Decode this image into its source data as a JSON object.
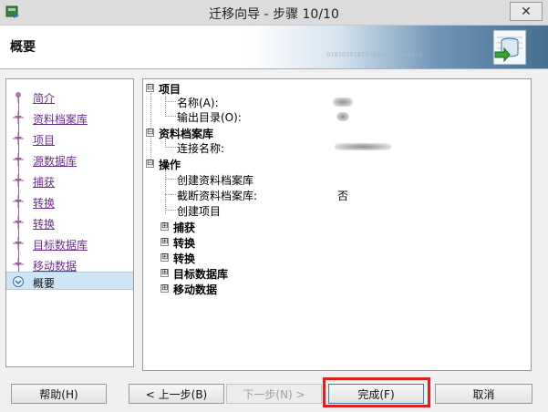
{
  "window": {
    "title": "迁移向导 - 步骤 10/10",
    "close_glyph": "✕"
  },
  "header": {
    "title": "概要",
    "binary_text": "0101010101010101010101010"
  },
  "nav": {
    "items": [
      {
        "label": "简介",
        "active": false
      },
      {
        "label": "资料档案库",
        "active": false
      },
      {
        "label": "项目",
        "active": false
      },
      {
        "label": "源数据库",
        "active": false
      },
      {
        "label": "捕获",
        "active": false
      },
      {
        "label": "转换",
        "active": false
      },
      {
        "label": "转换",
        "active": false
      },
      {
        "label": "目标数据库",
        "active": false
      },
      {
        "label": "移动数据",
        "active": false
      },
      {
        "label": "概要",
        "active": true
      }
    ]
  },
  "tree": {
    "project": {
      "label": "项目",
      "expander": "⊟",
      "name_label": "名称(A):",
      "output_label": "输出目录(O):"
    },
    "repository": {
      "label": "资料档案库",
      "expander": "⊟",
      "conn_label": "连接名称:"
    },
    "operations": {
      "label": "操作",
      "expander": "⊟",
      "create_repo": "创建资料档案库",
      "truncate_repo": "截断资料档案库:",
      "truncate_value": "否",
      "create_project": "创建项目",
      "children": [
        {
          "label": "捕获",
          "expander": "⊞"
        },
        {
          "label": "转换",
          "expander": "⊞"
        },
        {
          "label": "转换",
          "expander": "⊞"
        },
        {
          "label": "目标数据库",
          "expander": "⊞"
        },
        {
          "label": "移动数据",
          "expander": "⊞"
        }
      ]
    }
  },
  "buttons": {
    "help": "帮助(H)",
    "back": "< 上一步(B)",
    "next": "下一步(N) >",
    "finish": "完成(F)",
    "cancel": "取消"
  },
  "colors": {
    "highlight": "#e0201c",
    "nav_link": "#6b2e8f",
    "nav_active_bg": "#cfe4f5"
  }
}
